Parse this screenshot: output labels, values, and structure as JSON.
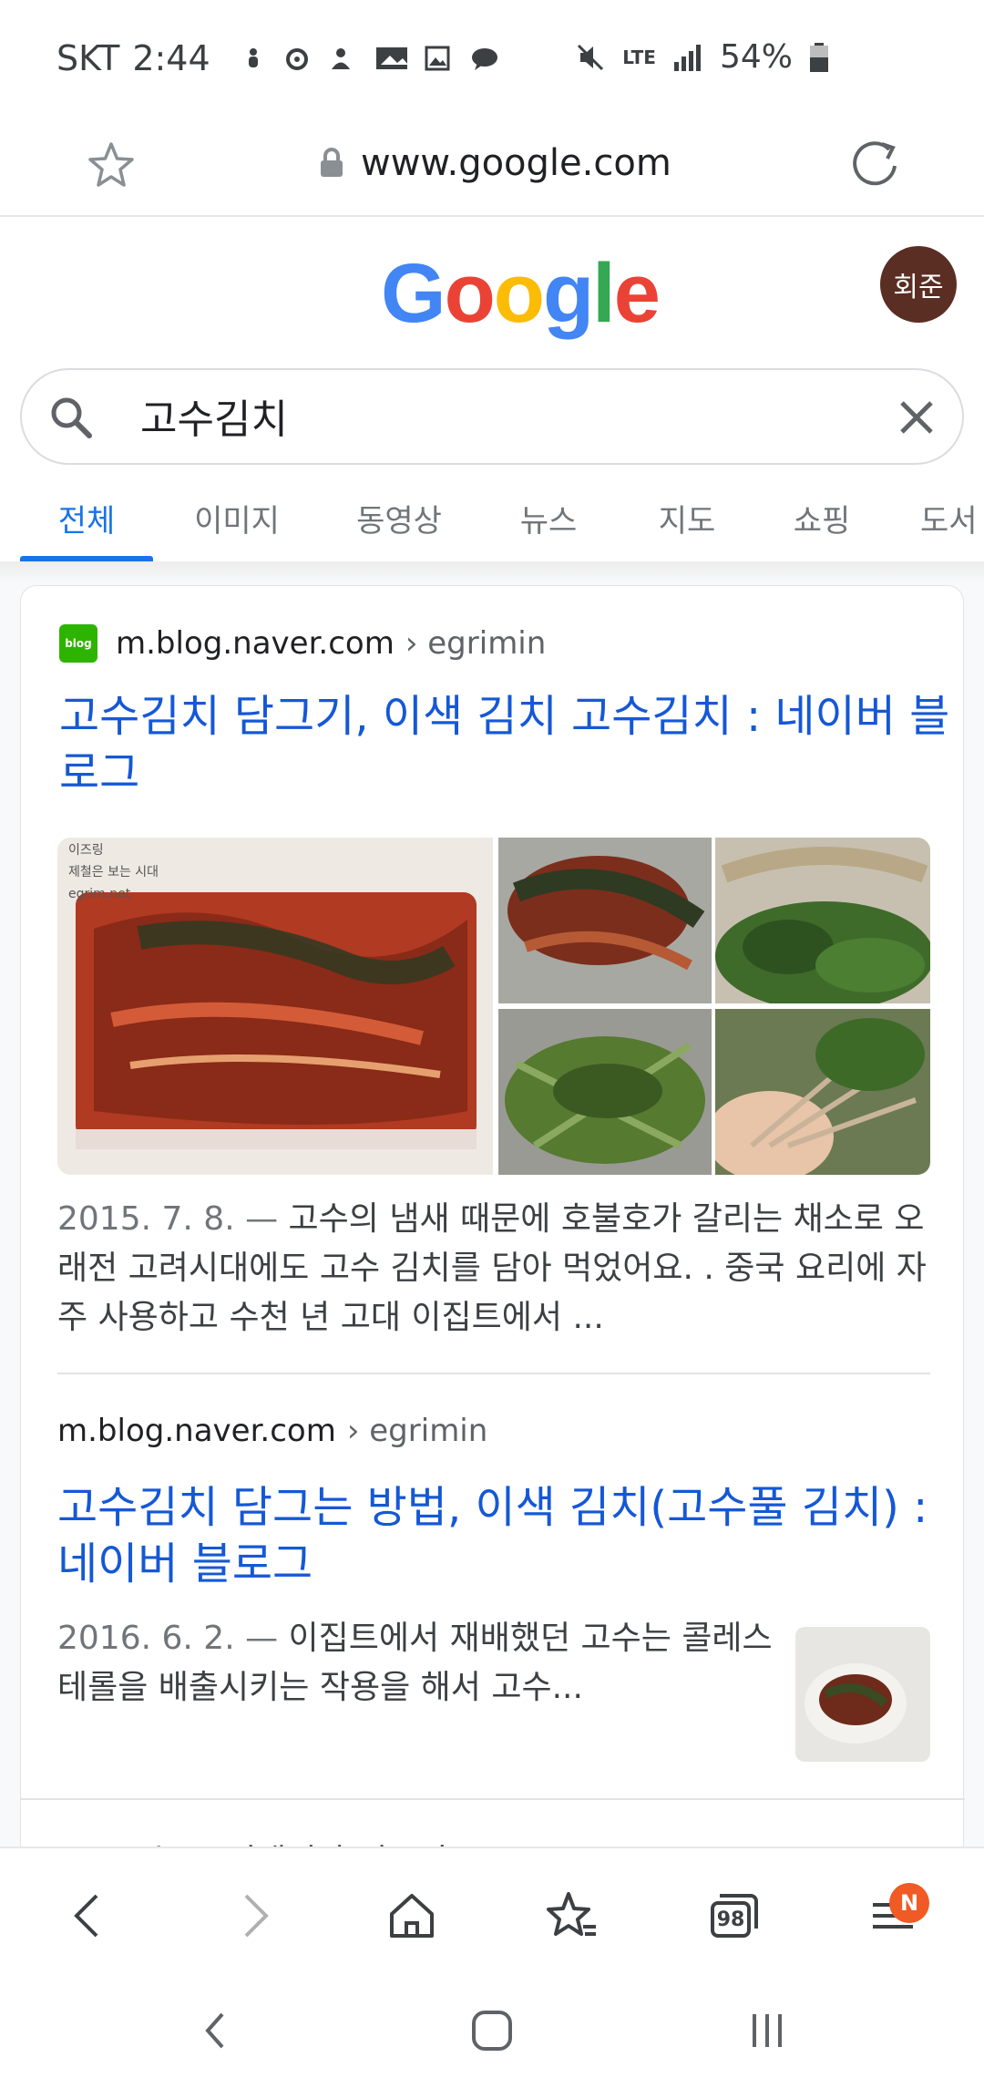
{
  "status_bar": {
    "carrier": "SKT",
    "time": "2:44",
    "network": "LTE",
    "battery": "54%"
  },
  "url_bar": {
    "url": "www.google.com"
  },
  "header": {
    "logo_letters": [
      {
        "ch": "G",
        "color": "#4285F4"
      },
      {
        "ch": "o",
        "color": "#EA4335"
      },
      {
        "ch": "o",
        "color": "#FBBC05"
      },
      {
        "ch": "g",
        "color": "#4285F4"
      },
      {
        "ch": "l",
        "color": "#34A853"
      },
      {
        "ch": "e",
        "color": "#EA4335"
      }
    ],
    "avatar_label": "회준"
  },
  "search": {
    "query": "고수김치"
  },
  "tabs": [
    {
      "label": "전체",
      "active": true
    },
    {
      "label": "이미지",
      "active": false
    },
    {
      "label": "동영상",
      "active": false
    },
    {
      "label": "뉴스",
      "active": false
    },
    {
      "label": "지도",
      "active": false
    },
    {
      "label": "쇼핑",
      "active": false
    },
    {
      "label": "도서",
      "active": false
    }
  ],
  "results": [
    {
      "favicon_label": "blog",
      "host": "m.blog.naver.com",
      "path": "› egrimin",
      "title": "고수김치 담그기, 이색 김치 고수김치 : 네이버 블로그",
      "date": "2015. 7. 8. —",
      "snippet": "고수의 냄새 때문에 호불호가 갈리는 채소로 오래전 고려시대에도 고수 김치를 담아 먹었어요. . 중국 요리에 자주 사용하고 수천 년 고대 이집트에서 ..."
    },
    {
      "host": "m.blog.naver.com",
      "path": "› egrimin",
      "title": "고수김치 담그는 방법, 이색 김치(고수풀 김치) : 네이버 블로그",
      "date": "2016. 6. 2. —",
      "snippet": "이집트에서 재배했던 고수는 콜레스테롤을 배출시키는 작용을 해서 고수..."
    }
  ],
  "partial_next": "> 고수 ... 검색결과 더보기",
  "bottom_nav": {
    "tabs_count": "98",
    "menu_badge": "N"
  },
  "colors": {
    "link_blue": "#1558d6",
    "tab_active": "#1a73e8",
    "avatar_bg": "#5a2e22",
    "badge": "#f05a24"
  }
}
